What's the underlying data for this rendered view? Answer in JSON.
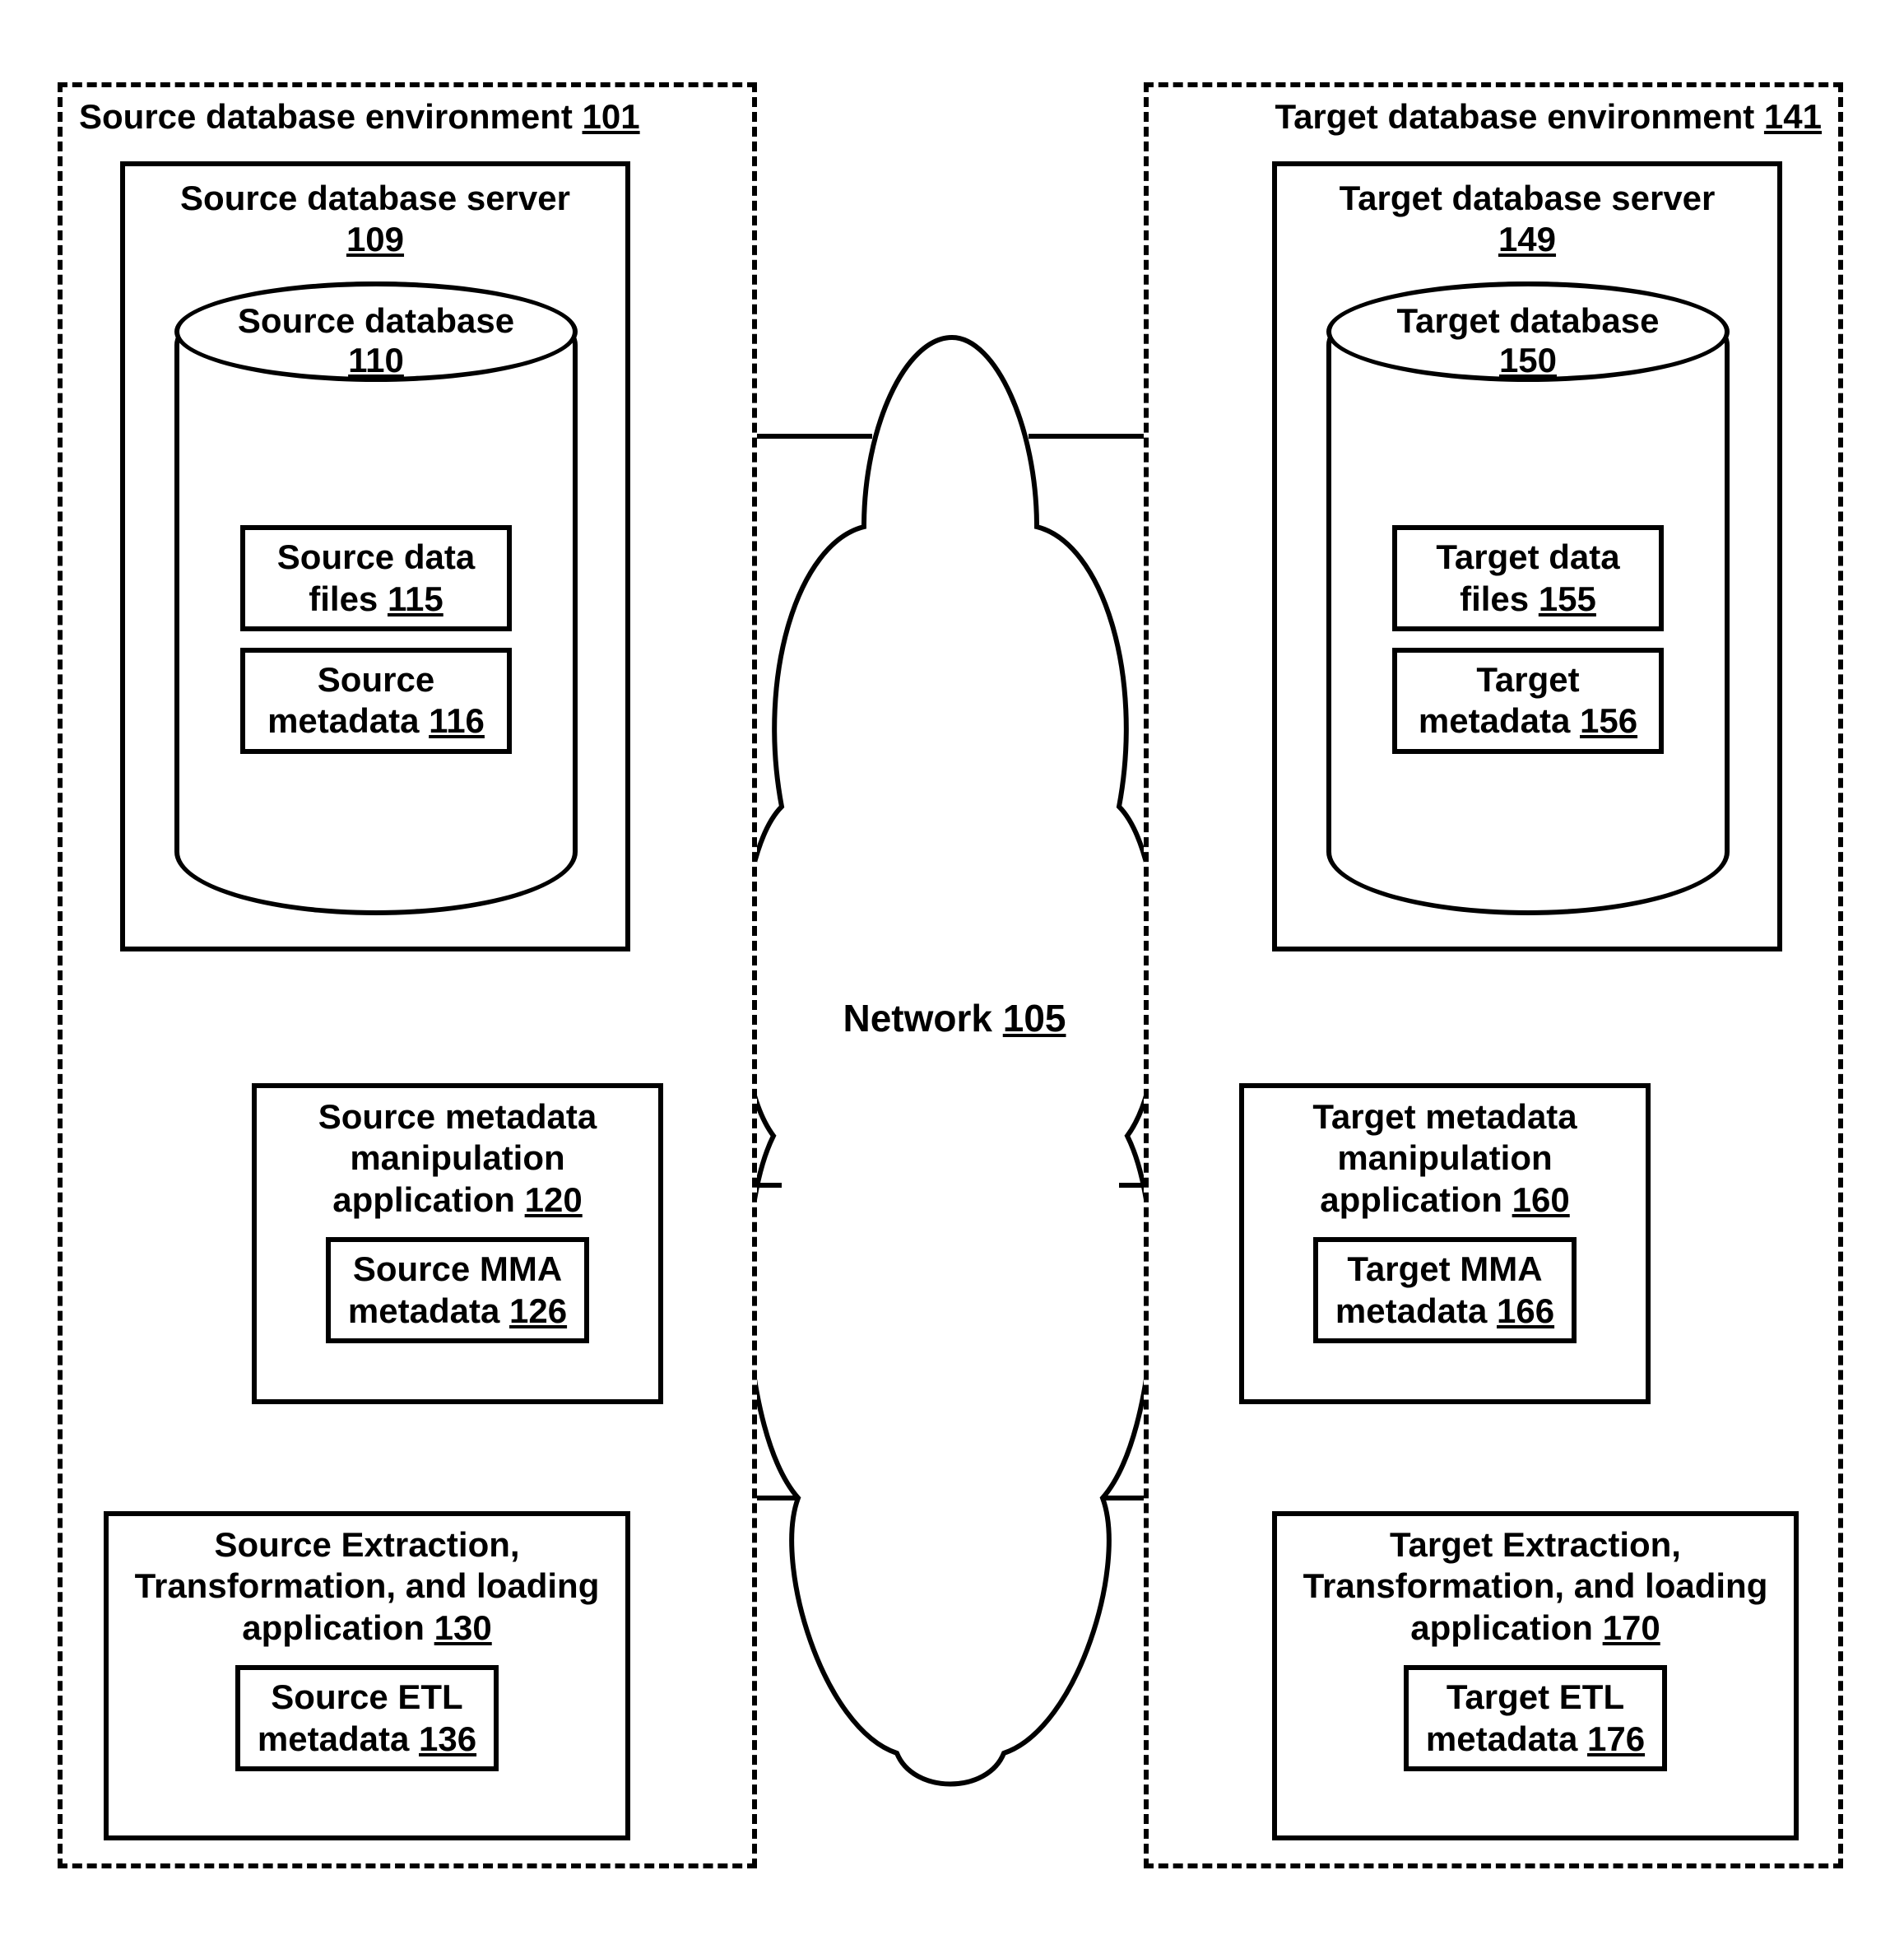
{
  "source_env": {
    "title": "Source database environment",
    "ref": "101"
  },
  "target_env": {
    "title": "Target database environment",
    "ref": "141"
  },
  "source_server": {
    "title": "Source database server",
    "ref": "109"
  },
  "target_server": {
    "title": "Target database server",
    "ref": "149"
  },
  "source_db": {
    "title": "Source database",
    "ref": "110"
  },
  "target_db": {
    "title": "Target database",
    "ref": "150"
  },
  "source_data_files": {
    "title": "Source data files",
    "ref": "115"
  },
  "target_data_files": {
    "title": "Target data files",
    "ref": "155"
  },
  "source_metadata": {
    "title": "Source metadata",
    "ref": "116"
  },
  "target_metadata": {
    "title": "Target metadata",
    "ref": "156"
  },
  "source_mma": {
    "title": "Source metadata manipulation application",
    "ref": "120"
  },
  "target_mma": {
    "title": "Target metadata manipulation application",
    "ref": "160"
  },
  "source_mma_meta": {
    "title": "Source MMA metadata",
    "ref": "126"
  },
  "target_mma_meta": {
    "title": "Target MMA metadata",
    "ref": "166"
  },
  "source_etl": {
    "title": "Source Extraction, Transformation, and loading application",
    "ref": "130"
  },
  "target_etl": {
    "title": "Target Extraction, Transformation, and loading application",
    "ref": "170"
  },
  "source_etl_meta": {
    "title": "Source ETL metadata",
    "ref": "136"
  },
  "target_etl_meta": {
    "title": "Target ETL metadata",
    "ref": "176"
  },
  "network": {
    "title": "Network",
    "ref": "105"
  }
}
